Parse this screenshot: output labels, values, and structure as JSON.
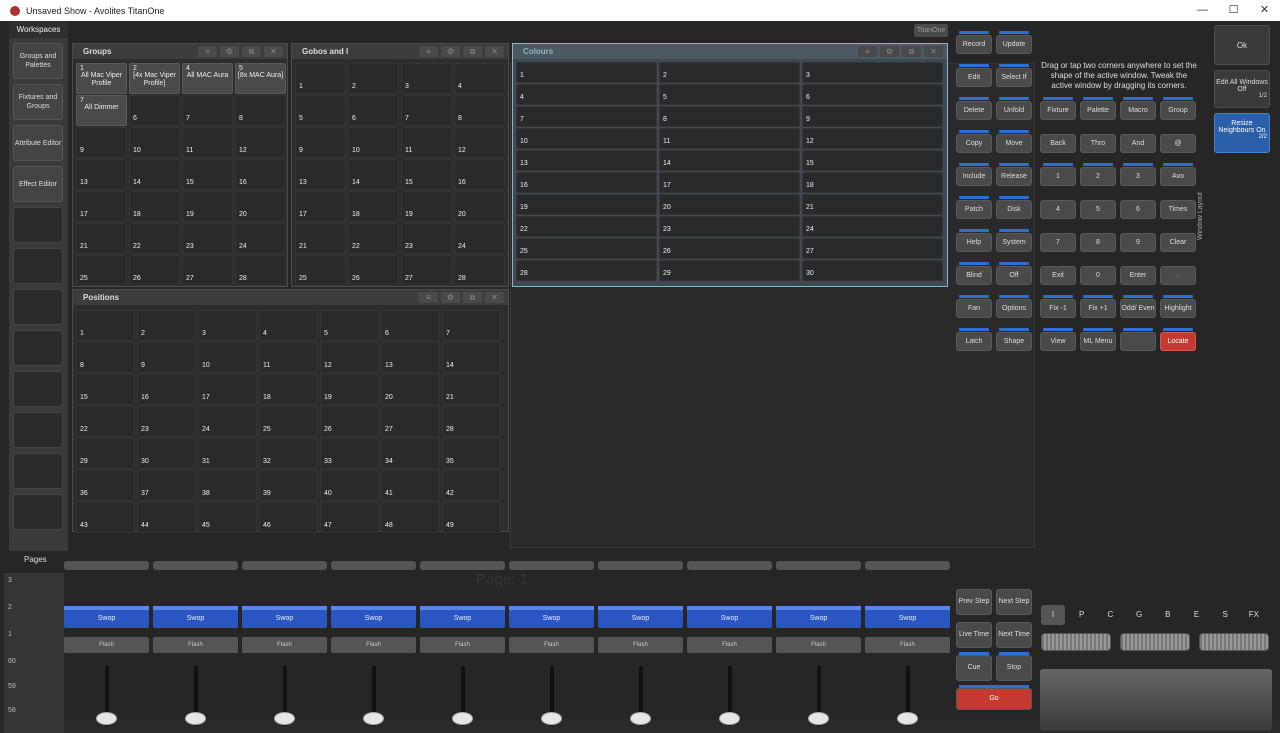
{
  "titlebar": {
    "title": "Unsaved Show - Avolites TitanOne",
    "min": "—",
    "max": "☐",
    "close": "✕"
  },
  "workspaces": {
    "header": "Workspaces",
    "items": [
      "Groups and Palettes",
      "Fixtures and Groups",
      "Attribute Editor",
      "Effect Editor"
    ]
  },
  "titanone_tab": "TitanOne",
  "groups": {
    "title": "Groups",
    "filled": [
      {
        "n": "1",
        "label": "All Mac Viper Profile"
      },
      {
        "n": "2",
        "label": "[4x Mac Viper Profile]"
      },
      {
        "n": "4",
        "label": "All MAC Aura"
      },
      {
        "n": "5",
        "label": "[8x MAC Aura]"
      },
      {
        "n": "7",
        "label": "All Dimmer"
      }
    ],
    "numbers": [
      "6",
      "7",
      "8",
      "9",
      "10",
      "11",
      "12",
      "13",
      "14",
      "15",
      "16",
      "17",
      "18",
      "19",
      "20",
      "21",
      "22",
      "23",
      "24",
      "25",
      "26",
      "27",
      "28"
    ]
  },
  "gobos": {
    "title": "Gobos and I",
    "numbers": [
      "1",
      "2",
      "3",
      "4",
      "5",
      "6",
      "7",
      "8",
      "9",
      "10",
      "11",
      "12",
      "13",
      "14",
      "15",
      "16",
      "17",
      "18",
      "19",
      "20",
      "21",
      "22",
      "23",
      "24",
      "25",
      "26",
      "27",
      "28"
    ]
  },
  "colours": {
    "title": "Colours",
    "numbers": [
      "1",
      "2",
      "3",
      "4",
      "5",
      "6",
      "7",
      "8",
      "9",
      "10",
      "11",
      "12",
      "13",
      "14",
      "15",
      "16",
      "17",
      "18",
      "19",
      "20",
      "21",
      "22",
      "23",
      "24",
      "25",
      "26",
      "27",
      "28",
      "29",
      "30"
    ]
  },
  "positions": {
    "title": "Positions",
    "numbers": [
      "1",
      "2",
      "3",
      "4",
      "5",
      "6",
      "7",
      "8",
      "9",
      "10",
      "11",
      "12",
      "13",
      "14",
      "15",
      "16",
      "17",
      "18",
      "19",
      "20",
      "21",
      "22",
      "23",
      "24",
      "25",
      "26",
      "27",
      "28",
      "29",
      "30",
      "31",
      "32",
      "33",
      "34",
      "35",
      "36",
      "37",
      "38",
      "39",
      "40",
      "41",
      "42",
      "43",
      "44",
      "45",
      "46",
      "47",
      "48",
      "49"
    ]
  },
  "controls": [
    [
      "Record",
      "Update"
    ],
    [
      "Edit",
      "Select If"
    ],
    [
      "Delete",
      "Unfold"
    ],
    [
      "Copy",
      "Move"
    ],
    [
      "Include",
      "Release"
    ],
    [
      "Patch",
      "Disk"
    ],
    [
      "Help",
      "System"
    ],
    [
      "Blind",
      "Off"
    ],
    [
      "Fan",
      "Options"
    ],
    [
      "Latch",
      "Shape"
    ]
  ],
  "keypad": [
    [
      "Fixture",
      "Palette",
      "Macro",
      "Group"
    ],
    [
      "Back",
      "Thro",
      "And",
      "@"
    ],
    [
      "1",
      "2",
      "3",
      "Avo"
    ],
    [
      "4",
      "5",
      "6",
      "Times"
    ],
    [
      "7",
      "8",
      "9",
      "Clear"
    ],
    [
      "Exit",
      "0",
      "Enter",
      "."
    ],
    [
      "Fix -1",
      "Fix +1",
      "Odd/ Even",
      "Highlight"
    ],
    [
      "View",
      "ML Menu",
      "",
      "Locate"
    ]
  ],
  "hint": "Drag or tap two corners anywhere to set the shape of the active window. Tweak the active window by dragging its corners.",
  "right": {
    "ok": "Ok",
    "edit_all": "Edit All Windows Off",
    "edit_all_page": "1/2",
    "resize": "Resize Neighbours On",
    "resize_page": "2/2",
    "window_layout": "Window Layout"
  },
  "pages": {
    "label": "Pages",
    "page_label": "Page: 1",
    "scale": [
      "3",
      "2",
      "1",
      "60",
      "59",
      "58"
    ]
  },
  "faders": {
    "swop": "Swop",
    "flash": "Flash",
    "count": 10
  },
  "playback": [
    [
      "Prev Step",
      "Next Step"
    ],
    [
      "Live Time",
      "Next Time"
    ],
    [
      "Cue",
      "Stop"
    ]
  ],
  "go": "Go",
  "letters": [
    "I",
    "P",
    "C",
    "G",
    "B",
    "E",
    "S",
    "FX"
  ]
}
